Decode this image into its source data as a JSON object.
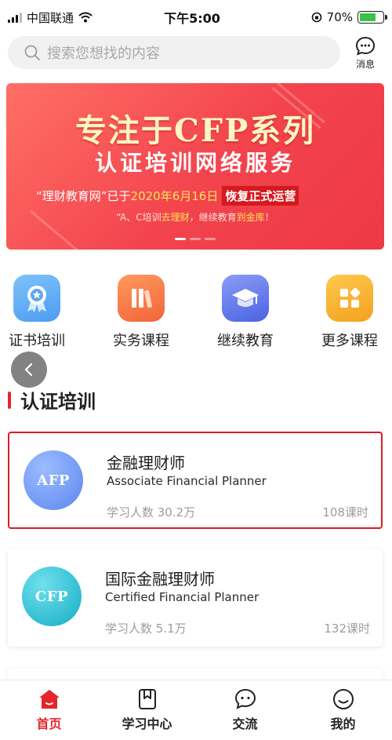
{
  "status_bar": {
    "carrier": "中国联通",
    "time": "下午5:00",
    "battery_percent": "70%",
    "battery_level": 0.7,
    "battery_color": "#3ac146"
  },
  "search": {
    "placeholder": "搜索您想找的内容",
    "icon": "search-icon"
  },
  "messages": {
    "label": "消息",
    "icon": "chat-bubble-icon"
  },
  "banner": {
    "title": "专注于CFP系列",
    "subtitle": "认证培训网络服务",
    "line_prefix": "“理财教育网”已于",
    "line_date": "2020年6月16日",
    "line_tag": "恢复正式运营",
    "slogan_prefix": "“A、C培训",
    "slogan_mid": "去理财",
    "slogan_middle": "，继续教育",
    "slogan_end": "到金库",
    "slogan_suffix": "！",
    "pages": 3,
    "active_page": 1,
    "colors": {
      "background": "#f3434d",
      "title": "#fff6c2",
      "highlight": "#ffe45c",
      "tag": "#d7181d"
    }
  },
  "quick_menu": [
    {
      "label": "证书培训",
      "icon": "certificate-badge-icon",
      "color": "#56a8f5"
    },
    {
      "label": "实务课程",
      "icon": "books-icon",
      "color": "#f7743f"
    },
    {
      "label": "继续教育",
      "icon": "graduation-cap-icon",
      "color": "#5b74ea"
    },
    {
      "label": "更多课程",
      "icon": "grid-more-icon",
      "color": "#f6ad2d"
    }
  ],
  "back_button": {
    "icon": "chevron-left-icon"
  },
  "section": {
    "title": "认证培训",
    "accent": "#e3252c"
  },
  "courses": [
    {
      "logo_text": "AFP",
      "name_cn": "金融理财师",
      "name_en": "Associate Financial Planner",
      "learners": "学习人数 30.2万",
      "hours": "108课时",
      "selected": true,
      "logo_color": "#6c95f0"
    },
    {
      "logo_text": "CFP",
      "name_cn": "国际金融理财师",
      "name_en": "Certified Financial Planner",
      "learners": "学习人数 5.1万",
      "hours": "132课时",
      "selected": false,
      "logo_color": "#21b8cf"
    }
  ],
  "tab_bar": [
    {
      "label": "首页",
      "icon": "home-icon",
      "active": true
    },
    {
      "label": "学习中心",
      "icon": "bookmark-book-icon",
      "active": false
    },
    {
      "label": "交流",
      "icon": "chat-icon",
      "active": false
    },
    {
      "label": "我的",
      "icon": "smiley-profile-icon",
      "active": false
    }
  ],
  "accent_color": "#e3252c"
}
